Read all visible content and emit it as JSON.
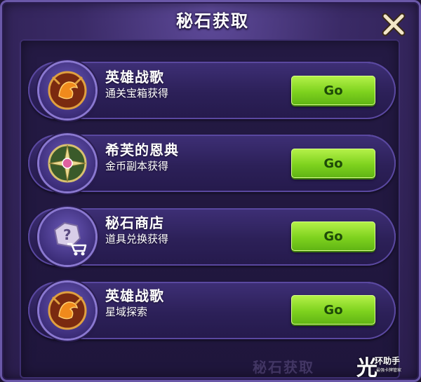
{
  "dialog": {
    "title": "秘石获取",
    "close_icon": "close-x-icon"
  },
  "sources": [
    {
      "title": "英雄战歌",
      "subtitle": "通关宝箱获得",
      "icon": "hero-anthem-icon",
      "button": "Go"
    },
    {
      "title": "希芙的恩典",
      "subtitle": "金币副本获得",
      "icon": "sif-grace-icon",
      "button": "Go"
    },
    {
      "title": "秘石商店",
      "subtitle": "道具兑换获得",
      "icon": "shop-cart-icon",
      "button": "Go"
    },
    {
      "title": "英雄战歌",
      "subtitle": "星域探索",
      "icon": "hero-anthem-icon",
      "button": "Go"
    }
  ],
  "watermark": {
    "text": "秘石获取"
  },
  "logo": {
    "glyph": "光",
    "name": "环助手",
    "tagline": "最强卡牌管家"
  },
  "colors": {
    "button_green": "#7ed21e",
    "panel_purple": "#3a2a66",
    "card_purple": "#2c2058"
  }
}
